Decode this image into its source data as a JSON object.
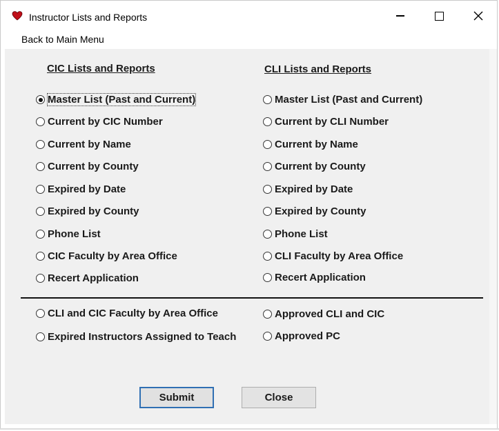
{
  "window": {
    "title": "Instructor Lists and Reports",
    "icon": "heart-icon",
    "accent_color": "#c0101a"
  },
  "menu": {
    "back_label": "Back to Main Menu"
  },
  "cic": {
    "header": "CIC Lists and Reports",
    "options": [
      "Master List (Past and Current)",
      "Current by CIC Number",
      "Current by Name",
      "Current by County",
      "Expired by Date",
      "Expired by County",
      "Phone List",
      "CIC Faculty by Area Office",
      "Recert Application"
    ],
    "selected_index": 0
  },
  "cli": {
    "header": "CLI Lists and Reports",
    "options": [
      "Master List (Past and Current)",
      "Current by CLI Number",
      "Current by Name",
      "Current by County",
      "Expired by Date",
      "Expired by County",
      "Phone List",
      "CLI Faculty by Area Office",
      "Recert Application"
    ]
  },
  "other": {
    "left": [
      "CLI and CIC Faculty by Area Office",
      "Expired Instructors Assigned to Teach"
    ],
    "right": [
      "Approved CLI and CIC",
      "Approved PC"
    ]
  },
  "buttons": {
    "submit": "Submit",
    "close": "Close"
  }
}
